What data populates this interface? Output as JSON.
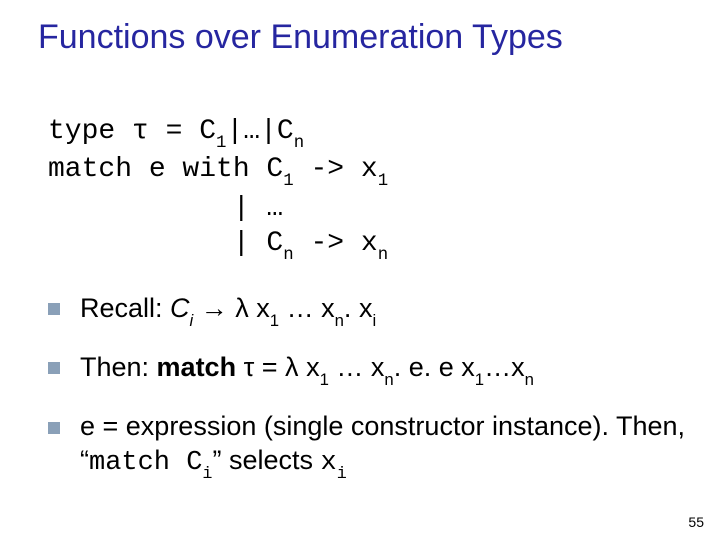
{
  "title": "Functions over Enumeration Types",
  "code": {
    "l1a": "type ",
    "l1tau": "τ",
    "l1b": " = C",
    "l1s1": "1",
    "l1c": "|…|C",
    "l1sn": "n",
    "l2a": "match e with C",
    "l2s1": "1",
    "l2b": " -> x",
    "l2s2": "1",
    "l3": "           | …",
    "l4a": "           | C",
    "l4sn": "n",
    "l4b": " -> x",
    "l4sn2": "n"
  },
  "b1": {
    "a": "Recall: ",
    "ci_c": "C",
    "ci_i": "i",
    "arrow": " → ",
    "lam": "λ",
    "sp": " ",
    "x1_x": "x",
    "x1_1": "1",
    "dots": " … ",
    "xn_x": "x",
    "xn_n": "n",
    "dot": ". ",
    "xi_x": "x",
    "xi_i": "i"
  },
  "b2": {
    "a": "Then: ",
    "match": "match",
    "sp1": " ",
    "tau": "τ",
    "eq": " = ",
    "lam": "λ",
    "sp2": " ",
    "x1_x": "x",
    "x1_1": "1",
    "dots1": " … ",
    "xn_x": "x",
    "xn_n": "n",
    "dot": ". e. e ",
    "xa_x": "x",
    "xa_1": "1",
    "dots2": "…",
    "xb_x": "x",
    "xb_n": "n"
  },
  "b3": {
    "a": "e = expression (single constructor instance). Then, “",
    "m": "match C",
    "mi": "i",
    "b": "” selects ",
    "x": "x",
    "xi": "i"
  },
  "pagenum": "55"
}
